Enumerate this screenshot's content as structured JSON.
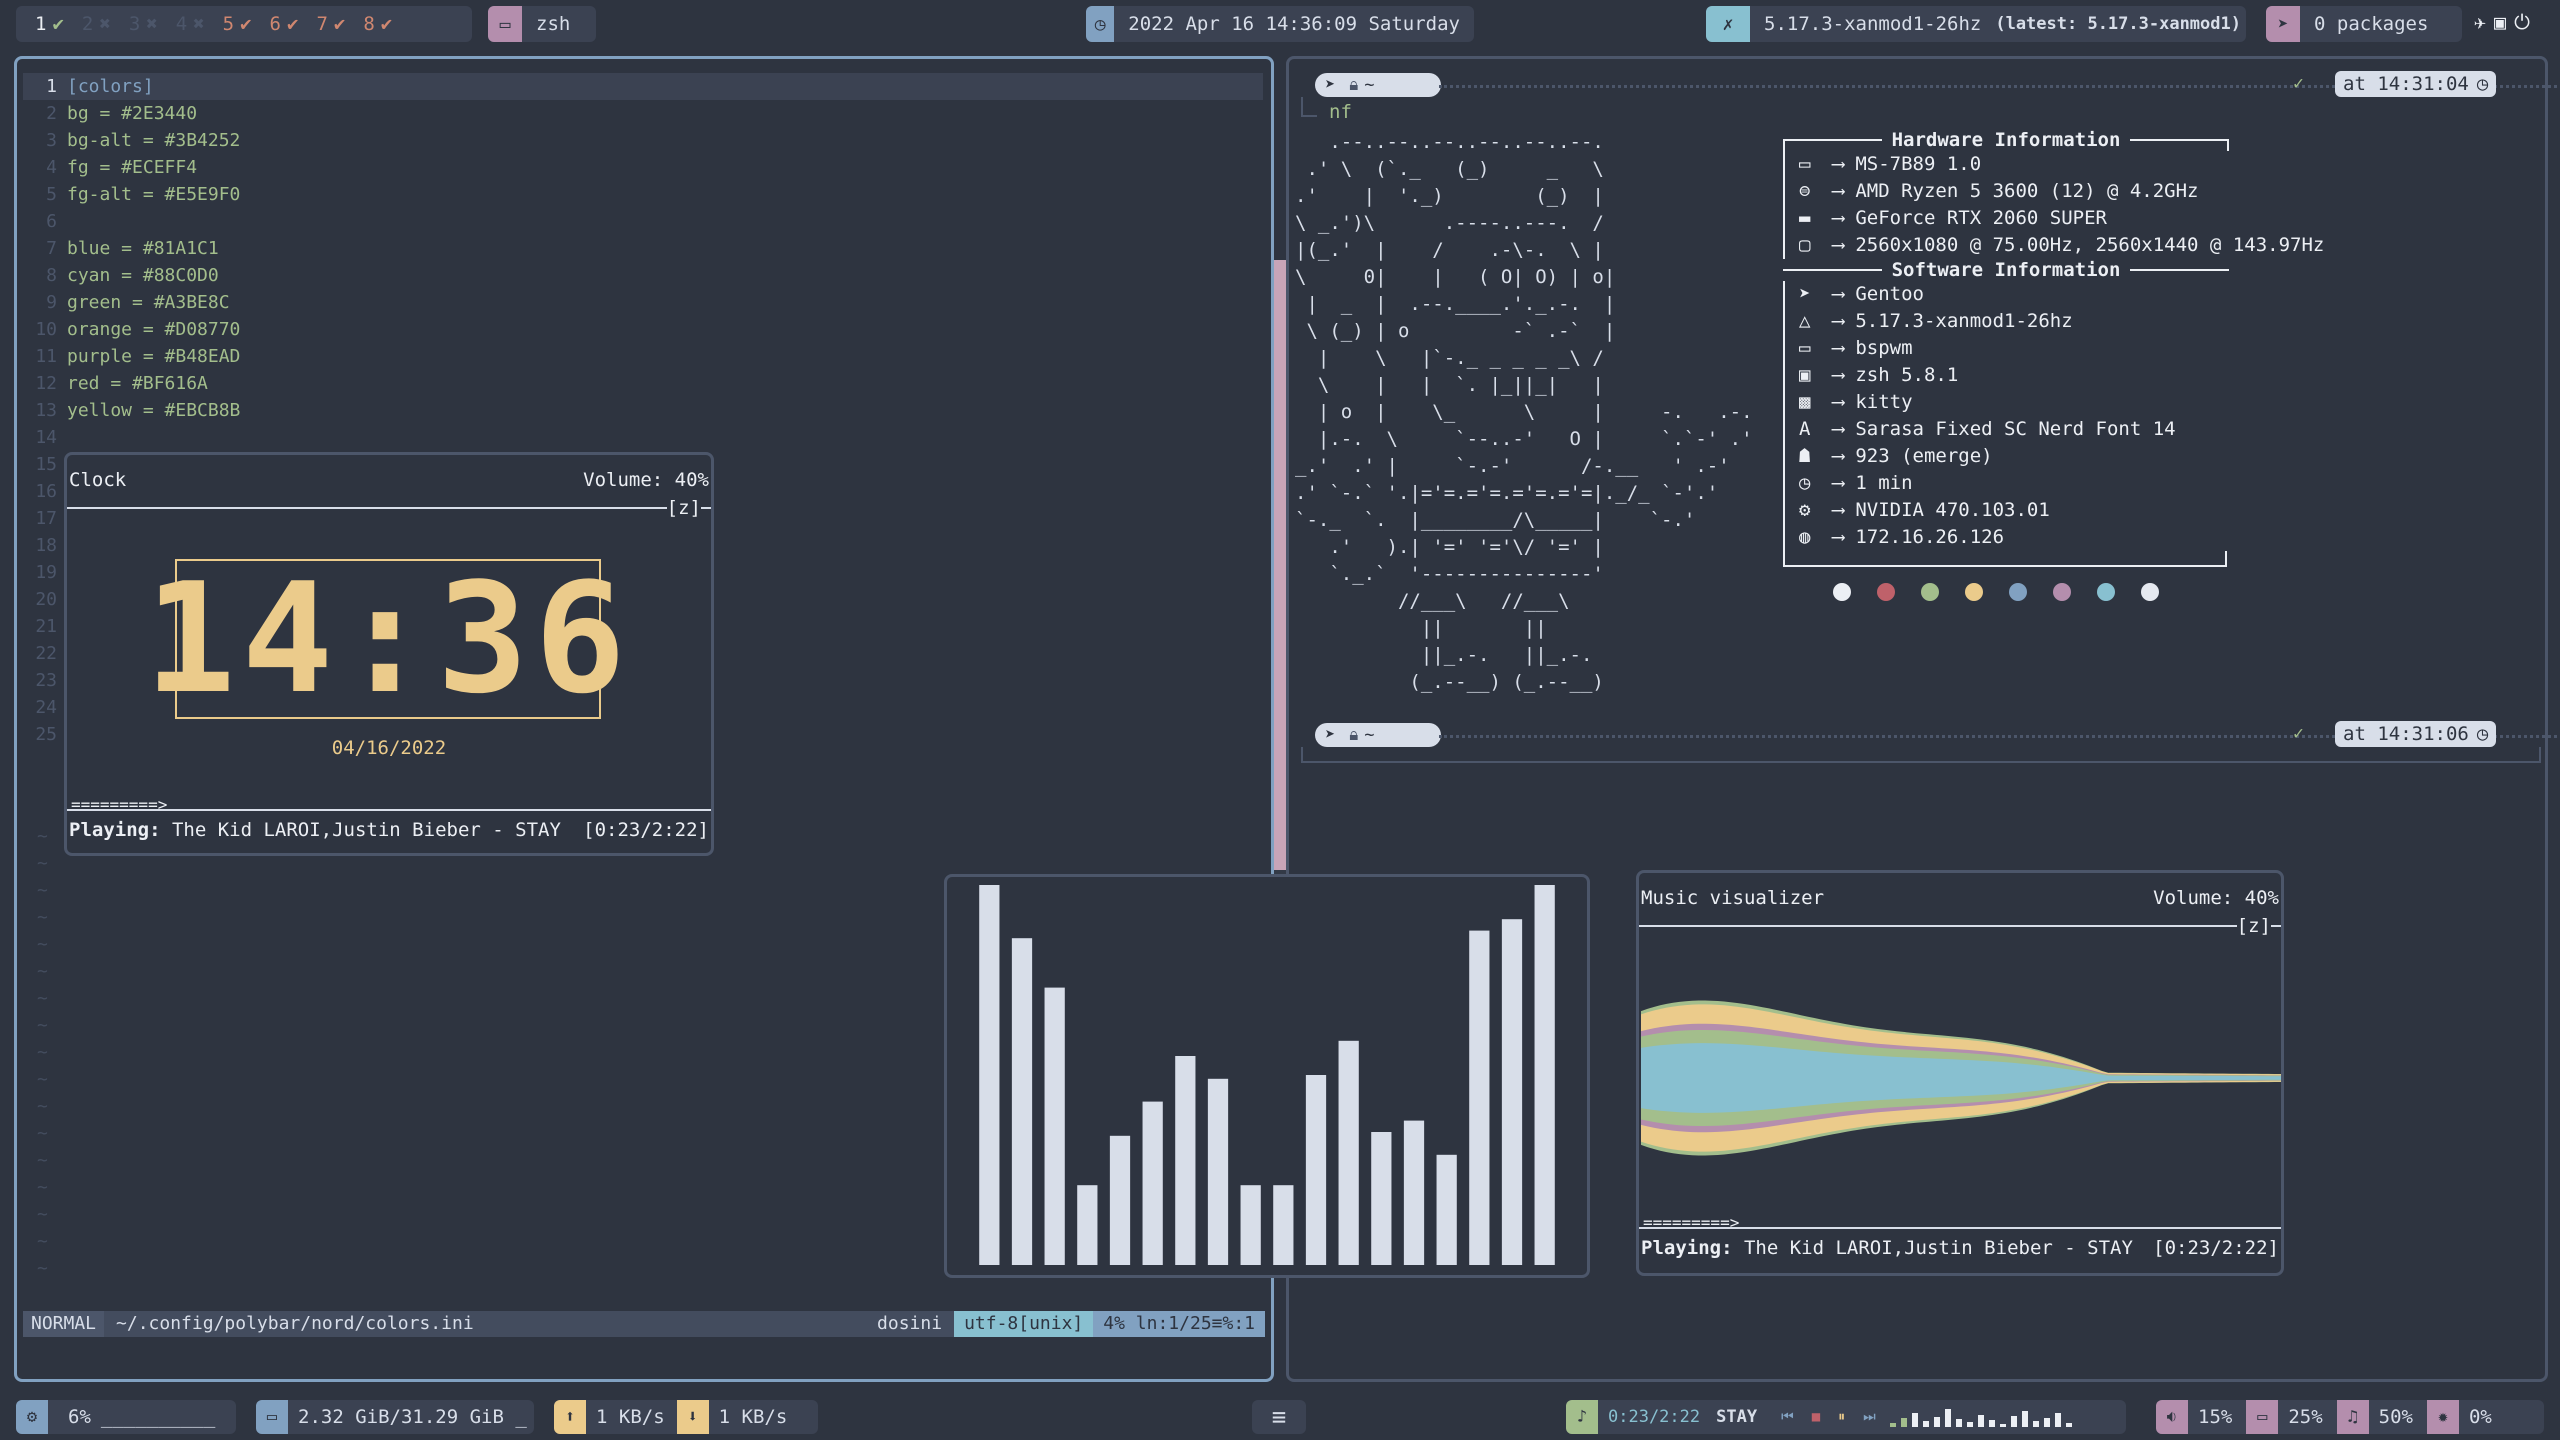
{
  "colors": {
    "bg": "#2E3440",
    "blue": "#81A1C1",
    "cyan": "#88C0D0",
    "green": "#A3BE8C",
    "orange": "#D08770",
    "purple": "#B48EAD",
    "red": "#BF616A",
    "yellow": "#EBCB8B",
    "fg": "#ECEFF4"
  },
  "topbar": {
    "workspaces": [
      {
        "num": "1",
        "mark": "✔",
        "active": true
      },
      {
        "num": "2",
        "mark": "✖",
        "active": false
      },
      {
        "num": "3",
        "mark": "✖",
        "active": false
      },
      {
        "num": "4",
        "mark": "✖",
        "active": false
      },
      {
        "num": "5",
        "mark": "✔",
        "active": true
      },
      {
        "num": "6",
        "mark": "✔",
        "active": true
      },
      {
        "num": "7",
        "mark": "✔",
        "active": true
      },
      {
        "num": "8",
        "mark": "✔",
        "active": true
      }
    ],
    "window_title": "zsh",
    "datetime": "2022 Apr 16 14:36:09 Saturday",
    "kernel": "5.17.3-xanmod1-26hz",
    "kernel_latest": "(latest: 5.17.3-xanmod1)",
    "packages": "0 packages"
  },
  "editor": {
    "lines": [
      {
        "n": "1",
        "text": "[colors]"
      },
      {
        "n": "2",
        "text": "bg = #2E3440"
      },
      {
        "n": "3",
        "text": "bg-alt = #3B4252"
      },
      {
        "n": "4",
        "text": "fg = #ECEFF4"
      },
      {
        "n": "5",
        "text": "fg-alt = #E5E9F0"
      },
      {
        "n": "6",
        "text": ""
      },
      {
        "n": "7",
        "text": "blue = #81A1C1"
      },
      {
        "n": "8",
        "text": "cyan = #88C0D0"
      },
      {
        "n": "9",
        "text": "green = #A3BE8C"
      },
      {
        "n": "10",
        "text": "orange = #D08770"
      },
      {
        "n": "11",
        "text": "purple = #B48EAD"
      },
      {
        "n": "12",
        "text": "red = #BF616A"
      },
      {
        "n": "13",
        "text": "yellow = #EBCB8B"
      },
      {
        "n": "14",
        "text": ""
      },
      {
        "n": "15",
        "text": ""
      },
      {
        "n": "16",
        "text": ""
      },
      {
        "n": "17",
        "text": ""
      },
      {
        "n": "18",
        "text": ""
      },
      {
        "n": "19",
        "text": ""
      },
      {
        "n": "20",
        "text": ""
      },
      {
        "n": "21",
        "text": ""
      },
      {
        "n": "22",
        "text": ""
      },
      {
        "n": "23",
        "text": ""
      },
      {
        "n": "24",
        "text": ""
      },
      {
        "n": "25",
        "text": ""
      }
    ],
    "status": {
      "mode": "NORMAL",
      "path": "~/.config/polybar/nord/colors.ini",
      "filetype": "dosini",
      "encoding": "utf-8[unix]",
      "pos": "4% ln:1/25≡%:1"
    }
  },
  "clock": {
    "title": "Clock",
    "volume": "Volume: 40%",
    "z": "[z]",
    "time": "14:36",
    "date": "04/16/2022",
    "progress": "=========>",
    "playing_label": "Playing:",
    "track": "The Kid LAROI,Justin Bieber - STAY",
    "elapsed": "[0:23/2:22]"
  },
  "neofetch": {
    "prompt_dir": "~",
    "cmd": "nf",
    "at": "at 14:31:04",
    "at2": "at 14:31:06",
    "ascii": [
      "   .--..--..--..--..--..--.",
      " .' \\  (`._   (_)     _   \\",
      ".'    |  '._)        (_)  |",
      "\\ _.')\\      .----..---.  /",
      "|(_.'  |    /    .-\\-.  \\ |",
      "\\     0|    |   ( O| O) | o|",
      " |  _  |  .--.____.'._.-.  |",
      " \\ (_) | o         -` .-`  |",
      "  |    \\   |`-._ _ _ _ _\\ /",
      "  \\    |   |  `. |_||_|   |",
      "  | o  |    \\_      \\     |     -.   .-.",
      "  |.-.  \\     `--..-'   O |     `.`-' .'",
      "_.'  .' |     `-.-'      /-.__   ' .-'",
      ".' `-.` '.|='=.='=.='=.='=|._/_ `-'.'",
      "`-._  `.  |________/\\_____|    `-.'",
      "   .'   ).| '=' '='\\/ '=' |",
      "   `._.`  '---------------'",
      "         //___\\   //___\\",
      "           ||       ||",
      "           ||_.-.   ||_.-.",
      "          (_.--__) (_.--__)"
    ],
    "hw_title": "Hardware Information",
    "sw_title": "Software Information",
    "hardware": [
      {
        "icon": "laptop-icon",
        "text": "MS-7B89 1.0"
      },
      {
        "icon": "cpu-icon",
        "text": "AMD Ryzen 5 3600 (12) @ 4.2GHz"
      },
      {
        "icon": "gpu-icon",
        "text": "GeForce RTX 2060 SUPER"
      },
      {
        "icon": "monitor-icon",
        "text": "2560x1080 @ 75.00Hz, 2560x1440 @ 143.97Hz"
      }
    ],
    "software": [
      {
        "icon": "gentoo-icon",
        "text": "Gentoo"
      },
      {
        "icon": "linux-icon",
        "text": "5.17.3-xanmod1-26hz"
      },
      {
        "icon": "window-icon",
        "text": "bspwm"
      },
      {
        "icon": "terminal-icon",
        "text": "zsh 5.8.1"
      },
      {
        "icon": "kitty-icon",
        "text": "kitty"
      },
      {
        "icon": "font-icon",
        "text": "Sarasa Fixed SC Nerd Font 14"
      },
      {
        "icon": "ghost-icon",
        "text": "923 (emerge)"
      },
      {
        "icon": "clock-icon",
        "text": "1 min"
      },
      {
        "icon": "cogs-icon",
        "text": "NVIDIA 470.103.01"
      },
      {
        "icon": "globe-icon",
        "text": "172.16.26.126"
      }
    ],
    "swatches": [
      "#ECEFF4",
      "#BF616A",
      "#A3BE8C",
      "#EBCB8B",
      "#81A1C1",
      "#B48EAD",
      "#88C0D0",
      "#E5E9F0"
    ]
  },
  "cava": {
    "bars": [
      100,
      86,
      73,
      21,
      34,
      43,
      55,
      49,
      21,
      21,
      50,
      59,
      35,
      38,
      29,
      88,
      91,
      100
    ]
  },
  "visualizer": {
    "title": "Music visualizer",
    "volume": "Volume: 40%",
    "z": "[z]",
    "progress": "=========>",
    "playing_label": "Playing:",
    "track": "The Kid LAROI,Justin Bieber - STAY",
    "elapsed": "[0:23/2:22]"
  },
  "bottombar": {
    "cpu": "6%",
    "cpu_graph": "__________",
    "mem": "2.32 GiB/31.29 GiB _",
    "up": "1 KB/s",
    "down": "1 KB/s",
    "menu": "≡",
    "mpd_time": "0:23/2:22",
    "mpd_title": "STAY",
    "volume": "15%",
    "brightness": "25%",
    "music_vol": "50%",
    "mic": "0%"
  }
}
